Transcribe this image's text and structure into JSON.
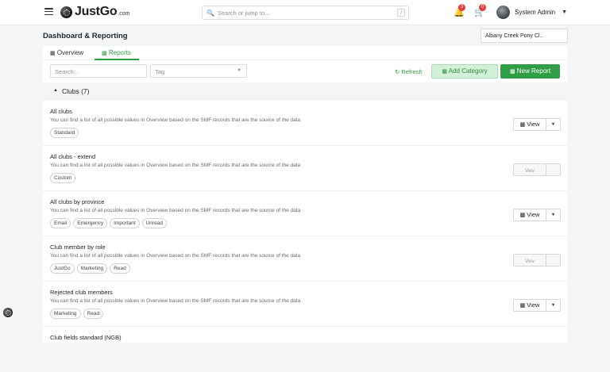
{
  "topbar": {
    "logo_text": "JustGo",
    "logo_suffix": ".com",
    "search_placeholder": "Search or jump to...",
    "search_shortcut": "/",
    "notifications_count": "3",
    "cart_count": "0",
    "user_name": "System Admin"
  },
  "page": {
    "title": "Dashboard & Reporting",
    "club_selector": "Albany Creek Pony Cl.."
  },
  "tabs": [
    {
      "label": "Overview"
    },
    {
      "label": "Reports"
    }
  ],
  "filters": {
    "search_placeholder": "Search...",
    "tag_placeholder": "Tag"
  },
  "toolbar": {
    "refresh": "Refresh",
    "add_category": "Add Category",
    "new_report": "New Report"
  },
  "group": {
    "title": "Clubs (7)"
  },
  "rows": [
    {
      "name": "All clubs",
      "desc": "You can find a list of all possible values in Overview based on the SMF records that are the source of the data",
      "tags": [
        "Standard"
      ],
      "view": "View"
    },
    {
      "name": "All clubs - extend",
      "desc": "You can find a list of all possible values in Overview based on the SMF records that are the source of the data",
      "tags": [
        "Custom"
      ],
      "view": "Viev"
    },
    {
      "name": "All clubs by province",
      "desc": "You can find a list of all possible values in Overview based on the SMF records that are the source of the data",
      "tags": [
        "Email",
        "Emergency",
        "Important",
        "Unread"
      ],
      "view": "View"
    },
    {
      "name": "Club member by role",
      "desc": "You can find a list of all possible values in Overview based on the SMF records that are the source of the data",
      "tags": [
        "JustGo",
        "Marketing",
        "Read"
      ],
      "view": "Viev"
    },
    {
      "name": "Rejected club members",
      "desc": "You can find a list of all possible values in Overview based on the SMF records that are the source of the data",
      "tags": [
        "Marketing",
        "Read"
      ],
      "view": "View"
    },
    {
      "name": "Club fields standard (NGB)",
      "desc": "",
      "tags": [],
      "view": ""
    }
  ],
  "colors": {
    "accent": "#2f9e44",
    "accent_light": "#d3f0d9",
    "badge": "#e53e3e"
  }
}
